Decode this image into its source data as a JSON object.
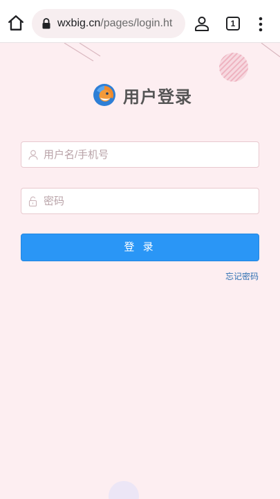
{
  "browser": {
    "url_host": "wxbig.cn",
    "url_path": "/pages/login.ht",
    "tab_count": "1"
  },
  "login": {
    "title": "用户登录",
    "username_placeholder": "用户名/手机号",
    "password_placeholder": "密码",
    "login_button": "登 录",
    "forgot_link": "忘记密码"
  },
  "colors": {
    "page_background": "#fdeef1",
    "primary_button": "#2a96f6",
    "link": "#2d6fb2"
  }
}
